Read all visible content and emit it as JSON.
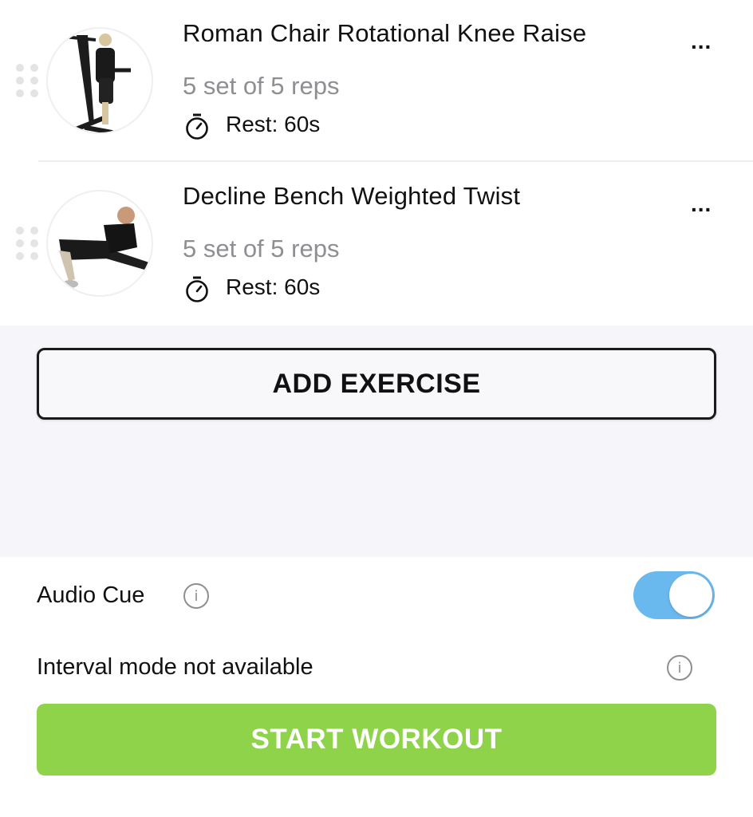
{
  "exercises": [
    {
      "title": "Roman Chair Rotational Knee Raise",
      "sets": "5 set of 5 reps",
      "rest": "Rest: 60s",
      "thumbnail": "roman-chair-knee-raise-image",
      "more_label": "..."
    },
    {
      "title": "Decline Bench Weighted Twist",
      "sets": "5 set of 5 reps",
      "rest": "Rest: 60s",
      "thumbnail": "decline-bench-twist-image",
      "more_label": "..."
    }
  ],
  "add_exercise": {
    "label": "ADD EXERCISE"
  },
  "settings": {
    "audio_cue": {
      "label": "Audio Cue",
      "enabled": true,
      "info_glyph": "i"
    },
    "interval_mode": {
      "label": "Interval mode not available",
      "info_glyph": "i"
    }
  },
  "start_workout": {
    "label": "START WORKOUT"
  },
  "colors": {
    "accent_green": "#8ed34a",
    "toggle_blue": "#6ab9ee",
    "secondary_text": "#8e8e93",
    "section_bg": "#f6f6fa"
  }
}
